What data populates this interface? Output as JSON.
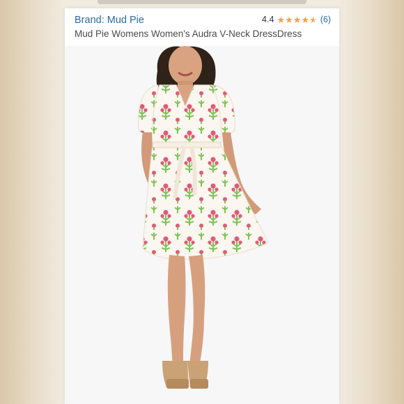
{
  "listing": {
    "brand": "Brand: Mud Pie",
    "rating": "4.4",
    "stars": 4.4,
    "review_count": "(6)",
    "title": "Mud Pie Womens Women's Audra V-Neck DressDress"
  },
  "colors": {
    "brand_link": "#2a6aa0",
    "star": "#f2a33b",
    "dress_pink": "#e05a7a",
    "dress_green": "#7fc25a"
  },
  "icons": [
    "star-icon"
  ]
}
